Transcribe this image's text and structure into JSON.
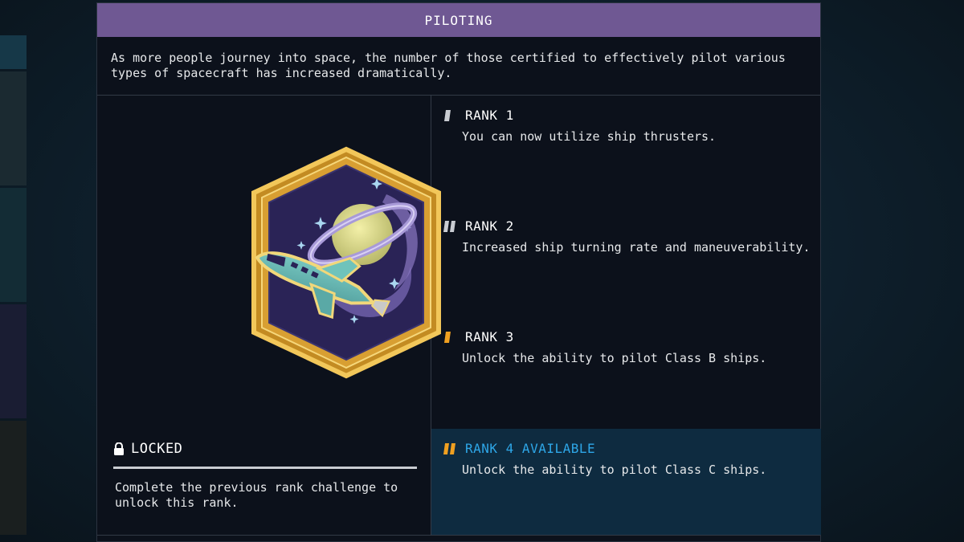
{
  "panel": {
    "title": "PILOTING",
    "description": "As more people journey into space, the number of those certified to effectively pilot various types of spacecraft has increased dramatically."
  },
  "status": {
    "label": "LOCKED",
    "icon": "lock-icon",
    "description": "Complete the previous rank challenge to unlock this rank."
  },
  "ranks": [
    {
      "title": "RANK 1",
      "description": "You can now utilize ship thrusters.",
      "marker_color": "#c9ccd2",
      "marker_count": 1
    },
    {
      "title": "RANK 2",
      "description": "Increased ship turning rate and maneuverability.",
      "marker_color": "#c9ccd2",
      "marker_count": 2
    },
    {
      "title": "RANK 3",
      "description": "Unlock the ability to pilot Class B ships.",
      "marker_color": "#f0a020",
      "marker_count": 1
    },
    {
      "title": "RANK 4 AVAILABLE",
      "description": "Unlock the ability to pilot Class C ships.",
      "marker_color": "#f0a020",
      "marker_count": 2
    }
  ],
  "colors": {
    "header_bg": "#6f5893",
    "panel_bg": "#0c111b",
    "available_bg": "#0e2b40",
    "available_text": "#2ea7e8",
    "patch_border": "#e8b94a",
    "patch_inner": "#2a2356"
  },
  "patch": {
    "icon": "piloting-skill-patch-icon"
  }
}
